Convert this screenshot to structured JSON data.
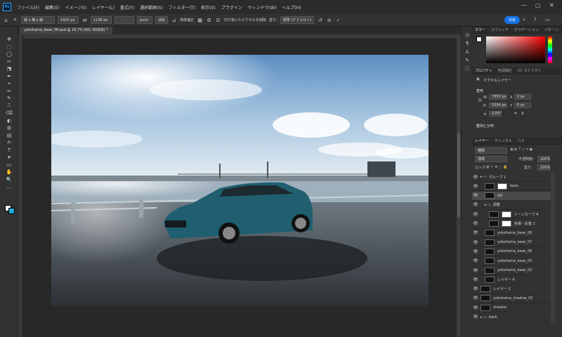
{
  "app": {
    "logo": "Ps"
  },
  "menu": [
    "ファイル(F)",
    "編集(E)",
    "イメージ(I)",
    "レイヤー(L)",
    "書式(Y)",
    "選択範囲(S)",
    "フィルター(T)",
    "表示(V)",
    "プラグイン",
    "ウィンドウ(W)",
    "ヘルプ(H)"
  ],
  "options": {
    "ratio": "縦 x 横 x 解",
    "width": "1920 px",
    "height": "1136 px",
    "unit": "px/in",
    "clear": "消去",
    "straighten": "角度補正",
    "delete_cropped": "切り抜いたピクセルを削除",
    "fill_label": "塗り:",
    "fill_value": "標準 (デフォルト)",
    "share": "共有"
  },
  "document": {
    "tab_title": "yokohama_base_08.psd @ 16.7% (AO, RGB/8) *"
  },
  "tools": [
    "✥",
    "⬚",
    "◯",
    "✂",
    "⬔",
    "✒",
    "⌖",
    "✏",
    "✎",
    "⎍",
    "⌫",
    "◐",
    "◍",
    "▤",
    "✍",
    "T",
    "➤",
    "▭",
    "✋",
    "🔍",
    "…"
  ],
  "color_panel": {
    "tabs": [
      "カラー",
      "スウォッチ",
      "グラデーション",
      "パターン"
    ]
  },
  "properties": {
    "tabs": [
      "プロパティ",
      "色調補正",
      "CC ライブラリ"
    ],
    "kind": "ピクセルレイヤー",
    "transform_label": "変形",
    "w_label": "W",
    "w": "7952 px",
    "h_label": "H",
    "h": "5304 px",
    "x_label": "X",
    "x": "0 px",
    "y_label": "Y",
    "y": "0 px",
    "angle": "0.00°",
    "align_label": "整列と分布"
  },
  "layers_panel": {
    "tabs": [
      "レイヤー",
      "チャンネル",
      "パス"
    ],
    "search": "種類",
    "blend": "通常",
    "opacity_label": "不透明度:",
    "opacity": "100%",
    "lock_label": "ロック:",
    "fill_label": "塗り:",
    "fill": "100%",
    "layers": [
      {
        "name": "グループ 1",
        "indent": 0,
        "group": true
      },
      {
        "name": "base",
        "indent": 1,
        "mask": true
      },
      {
        "name": "AO",
        "indent": 1,
        "selected": true
      },
      {
        "name": "調整",
        "indent": 1,
        "group": true
      },
      {
        "name": "トーンカーブ 4",
        "indent": 2,
        "mask": true
      },
      {
        "name": "色相・彩度 1",
        "indent": 2,
        "mask": true
      },
      {
        "name": "yokohama_base_08",
        "indent": 1
      },
      {
        "name": "yokohama_base_07",
        "indent": 1
      },
      {
        "name": "yokohama_base_06",
        "indent": 1
      },
      {
        "name": "yokohama_base_05",
        "indent": 1
      },
      {
        "name": "yokohama_base_02",
        "indent": 1
      },
      {
        "name": "レイヤー 4",
        "indent": 1
      },
      {
        "name": "レイヤー 2",
        "indent": 0
      },
      {
        "name": "yokohama_shadow_02",
        "indent": 0
      },
      {
        "name": "shadow",
        "indent": 0
      },
      {
        "name": "back",
        "indent": 0,
        "group": true
      }
    ]
  },
  "colors": {
    "accent": "#1473e6",
    "foreground": "#ffffff",
    "background": "#1ea7d8"
  }
}
